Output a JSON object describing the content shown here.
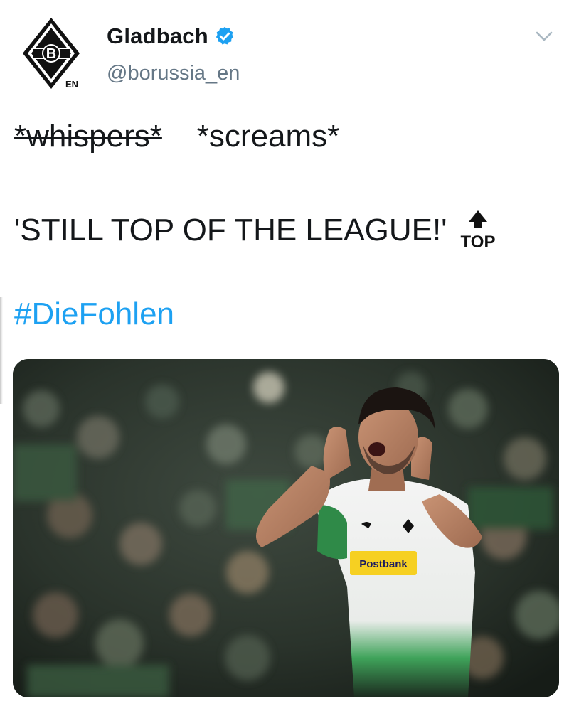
{
  "account": {
    "display_name": "Gladbach",
    "handle": "@borussia_en",
    "avatar_badge_letter": "B",
    "avatar_badge_suffix": "EN",
    "verified": true
  },
  "tweet": {
    "strikethrough_text": "*whispers*",
    "shout_text": "*screams*",
    "line2_text": "'STILL TOP OF THE LEAGUE!'",
    "emoji_label": "TOP",
    "hashtag": "#DieFohlen"
  },
  "media": {
    "jersey_sponsor": "Postbank",
    "image_icon": "photo-celebrating-player"
  },
  "colors": {
    "link": "#1da1f2",
    "handle": "#657786",
    "verified": "#1da1f2",
    "text": "#14171a"
  }
}
